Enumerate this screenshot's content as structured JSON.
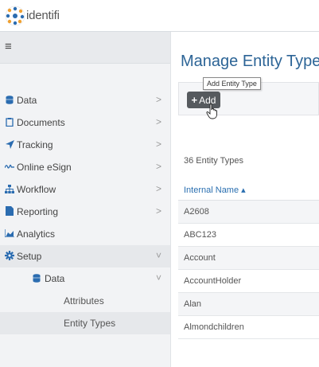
{
  "header": {
    "logo_text": "identifi"
  },
  "sidebar": {
    "menu_glyph": "≡",
    "items": [
      {
        "label": "Data",
        "icon": "database-icon",
        "chevron": ">"
      },
      {
        "label": "Documents",
        "icon": "document-icon",
        "chevron": ">"
      },
      {
        "label": "Tracking",
        "icon": "send-icon",
        "chevron": ">"
      },
      {
        "label": "Online eSign",
        "icon": "signature-icon",
        "chevron": ">"
      },
      {
        "label": "Workflow",
        "icon": "sitemap-icon",
        "chevron": ">"
      },
      {
        "label": "Reporting",
        "icon": "report-icon",
        "chevron": ">"
      },
      {
        "label": "Analytics",
        "icon": "area-chart-icon",
        "chevron": ""
      },
      {
        "label": "Setup",
        "icon": "gear-icon",
        "chevron": "˅"
      }
    ],
    "setup_sub": {
      "label": "Data",
      "icon": "database-icon",
      "chevron": "˅"
    },
    "data_sub": [
      {
        "label": "Attributes"
      },
      {
        "label": "Entity Types"
      }
    ]
  },
  "main": {
    "title": "Manage Entity Types",
    "add_button": {
      "plus": "+",
      "label": "Add"
    },
    "tooltip": "Add Entity Type",
    "count_text": "36 Entity Types",
    "table": {
      "column_header": "Internal Name ▴",
      "rows": [
        "A2608",
        "ABC123",
        "Account",
        "AccountHolder",
        "Alan",
        "Almondchildren"
      ]
    }
  },
  "colors": {
    "title_blue": "#2c6496",
    "link_blue": "#2a6fb0",
    "icon_blue": "#2b6cb0",
    "button_gray": "#565a5e"
  }
}
